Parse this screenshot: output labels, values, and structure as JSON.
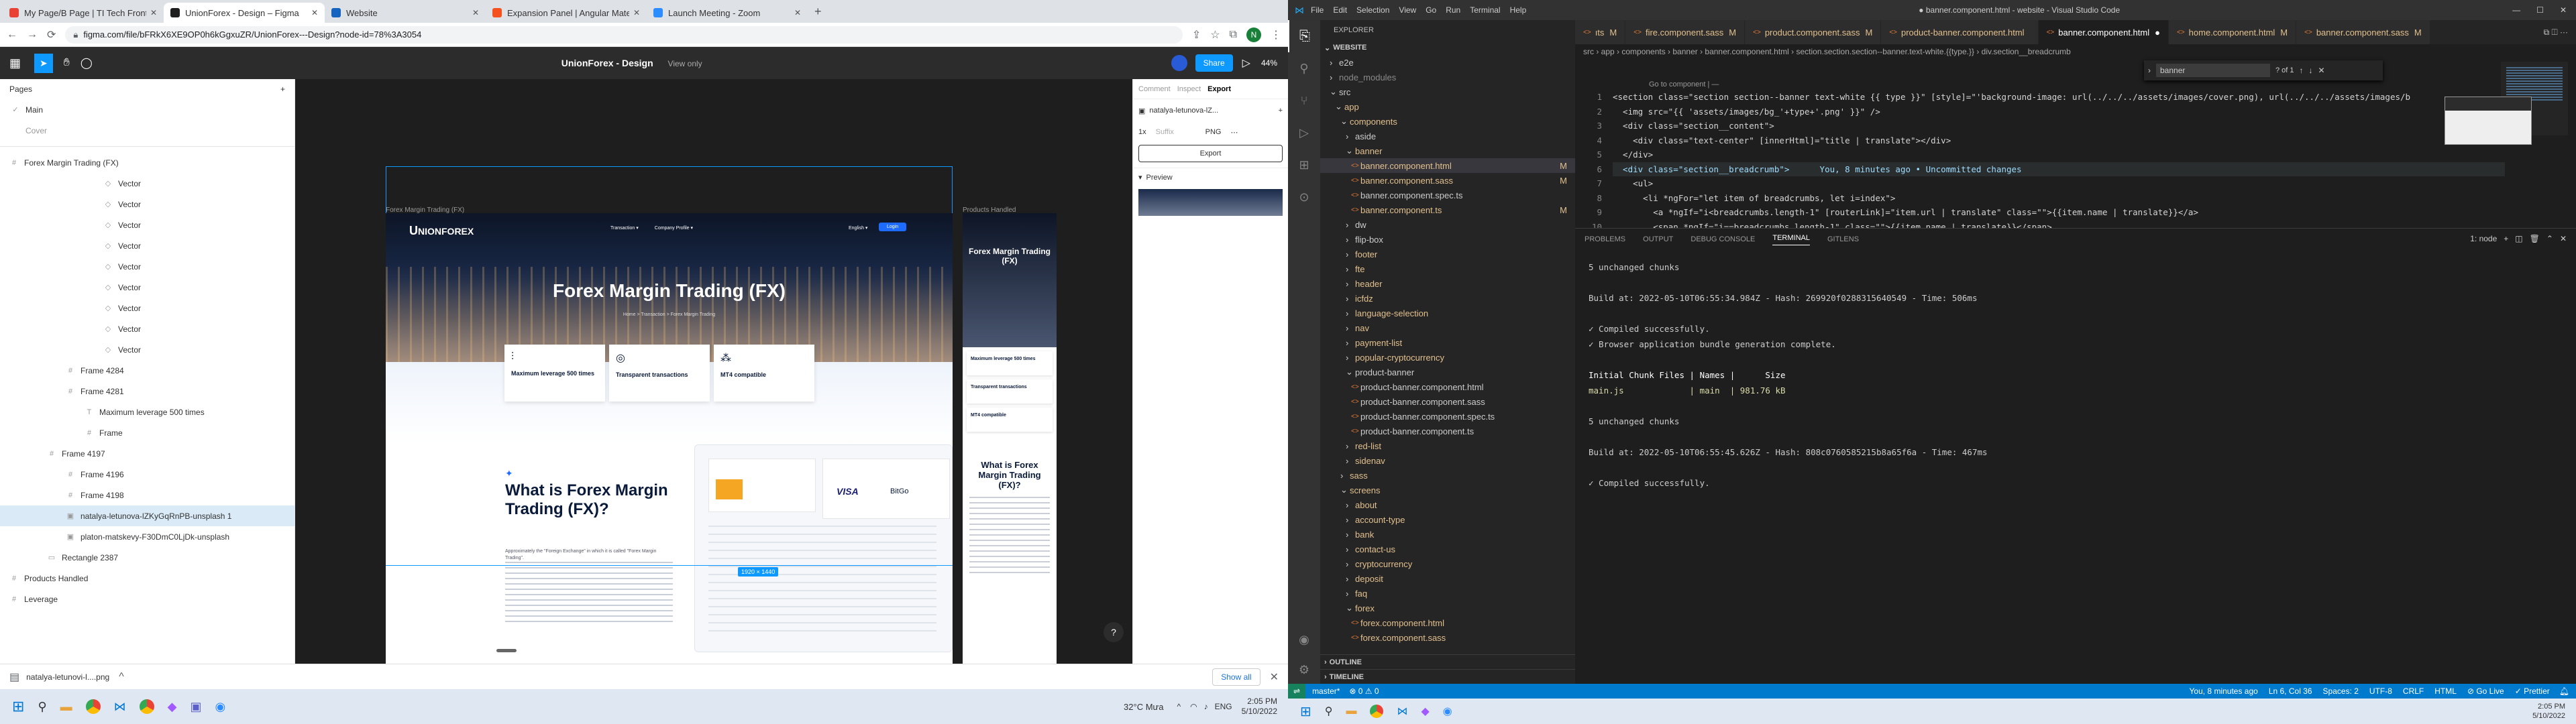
{
  "browser": {
    "tabs": [
      {
        "label": "My Page/B Page | TI Tech Front-...",
        "fav": "#e94235"
      },
      {
        "label": "UnionForex - Design – Figma",
        "fav": "#1e1e1e",
        "active": true
      },
      {
        "label": "Website",
        "fav": "#1565c0"
      },
      {
        "label": "Expansion Panel | Angular Mate...",
        "fav": "#f4511e"
      },
      {
        "label": "Launch Meeting - Zoom",
        "fav": "#2d8cff"
      }
    ],
    "url": "figma.com/file/bFRkX6XE9OP0h6kGgxuZR/UnionForex---Design?node-id=78%3A3054"
  },
  "figma": {
    "file_title": "UnionForex - Design",
    "view_mode": "View only",
    "share_label": "Share",
    "zoom": "44%",
    "pages_label": "Pages",
    "pages": [
      "Main",
      "Cover"
    ],
    "layers": [
      {
        "label": "Forex Margin Trading (FX)",
        "indent": 0,
        "icon": "#"
      },
      {
        "label": "Vector",
        "indent": 5,
        "icon": "◇"
      },
      {
        "label": "Vector",
        "indent": 5,
        "icon": "◇"
      },
      {
        "label": "Vector",
        "indent": 5,
        "icon": "◇"
      },
      {
        "label": "Vector",
        "indent": 5,
        "icon": "◇"
      },
      {
        "label": "Vector",
        "indent": 5,
        "icon": "◇"
      },
      {
        "label": "Vector",
        "indent": 5,
        "icon": "◇"
      },
      {
        "label": "Vector",
        "indent": 5,
        "icon": "◇"
      },
      {
        "label": "Vector",
        "indent": 5,
        "icon": "◇"
      },
      {
        "label": "Vector",
        "indent": 5,
        "icon": "◇"
      },
      {
        "label": "Frame 4284",
        "indent": 3,
        "icon": "#"
      },
      {
        "label": "Frame 4281",
        "indent": 3,
        "icon": "#"
      },
      {
        "label": "Maximum leverage 500 times",
        "indent": 4,
        "icon": "T"
      },
      {
        "label": "Frame",
        "indent": 4,
        "icon": "#"
      },
      {
        "label": "Frame 4197",
        "indent": 2,
        "icon": "#"
      },
      {
        "label": "Frame 4196",
        "indent": 3,
        "icon": "#"
      },
      {
        "label": "Frame 4198",
        "indent": 3,
        "icon": "#"
      },
      {
        "label": "natalya-letunova-lZKyGqRnPB-unsplash 1",
        "indent": 3,
        "icon": "▣",
        "selected": true
      },
      {
        "label": "platon-matskevy-F30DmC0LjDk-unsplash",
        "indent": 3,
        "icon": "▣"
      },
      {
        "label": "Rectangle 2387",
        "indent": 2,
        "icon": "▭"
      },
      {
        "label": "Products Handled",
        "indent": 0,
        "icon": "#"
      },
      {
        "label": "Leverage",
        "indent": 0,
        "icon": "#"
      }
    ],
    "right": {
      "tabs": [
        "Comment",
        "Inspect",
        "Export"
      ],
      "node_name": "natalya-letunova-lZ...",
      "scale": "1x",
      "suffix": "Suffix",
      "format": "PNG",
      "export_btn": "Export",
      "preview_label": "Preview"
    },
    "canvas": {
      "frame_label": "Forex Margin Trading (FX)",
      "frame2_label": "Products Handled",
      "hero_title": "Forex Margin Trading (FX)",
      "logo": "NIONFOREX",
      "logo_u": "U",
      "breadcrumb": "Home  >  Transaction  >  Forex Margin Trading",
      "nav": [
        "Transaction ▾",
        "Company Profile ▾"
      ],
      "lang": "English ▾",
      "login": "Login",
      "features": [
        "Maximum leverage 500 times",
        "Transparent transactions",
        "MT4 compatible"
      ],
      "what_title": "What is Forex Margin Trading (FX)?",
      "what_body": "Approximately the \"Foreign Exchange\" in which it is called \"Forex Margin Trading\".",
      "size_badge": "1920 × 1440",
      "visa": "VISA",
      "bitgo": "BitGo",
      "side_title": "Forex Margin Trading (FX)",
      "side_items": [
        "Maximum leverage 500 times",
        "Transparent transactions",
        "MT4 compatible"
      ],
      "side_what": "What is Forex Margin Trading (FX)?"
    },
    "download": {
      "file": "natalya-letunovi-l....png",
      "show_all": "Show all"
    }
  },
  "taskbar": {
    "weather": "32°C Mưa",
    "lang": "ENG",
    "time": "2:05 PM",
    "date": "5/10/2022"
  },
  "vscode": {
    "title": "● banner.component.html - website - Visual Studio Code",
    "menu": [
      "File",
      "Edit",
      "Selection",
      "View",
      "Go",
      "Run",
      "Terminal",
      "Help"
    ],
    "explorer_label": "EXPLORER",
    "workspace": "WEBSITE",
    "tree": [
      {
        "label": "e2e",
        "indent": 1,
        "type": "folder",
        "color": "#ccc"
      },
      {
        "label": "node_modules",
        "indent": 1,
        "type": "folder",
        "color": "#8a8a8a"
      },
      {
        "label": "src",
        "indent": 1,
        "type": "folder-open",
        "color": "#ccc"
      },
      {
        "label": "app",
        "indent": 2,
        "type": "folder-open",
        "color": "#e2c08d"
      },
      {
        "label": "components",
        "indent": 3,
        "type": "folder-open",
        "color": "#e2c08d"
      },
      {
        "label": "aside",
        "indent": 4,
        "type": "folder",
        "color": "#ccc"
      },
      {
        "label": "banner",
        "indent": 4,
        "type": "folder-open",
        "color": "#e2c08d"
      },
      {
        "label": "banner.component.html",
        "indent": 5,
        "type": "file",
        "color": "#e2c08d",
        "m": "M",
        "sel": true
      },
      {
        "label": "banner.component.sass",
        "indent": 5,
        "type": "file",
        "color": "#e2c08d",
        "m": "M"
      },
      {
        "label": "banner.component.spec.ts",
        "indent": 5,
        "type": "file",
        "color": "#ccc"
      },
      {
        "label": "banner.component.ts",
        "indent": 5,
        "type": "file",
        "color": "#e2c08d",
        "m": "M"
      },
      {
        "label": "dw",
        "indent": 4,
        "type": "folder",
        "color": "#ccc"
      },
      {
        "label": "flip-box",
        "indent": 4,
        "type": "folder",
        "color": "#ccc"
      },
      {
        "label": "footer",
        "indent": 4,
        "type": "folder",
        "color": "#e2c08d"
      },
      {
        "label": "fte",
        "indent": 4,
        "type": "folder",
        "color": "#e2c08d"
      },
      {
        "label": "header",
        "indent": 4,
        "type": "folder",
        "color": "#e2c08d"
      },
      {
        "label": "icfdz",
        "indent": 4,
        "type": "folder",
        "color": "#e2c08d"
      },
      {
        "label": "language-selection",
        "indent": 4,
        "type": "folder",
        "color": "#e2c08d"
      },
      {
        "label": "nav",
        "indent": 4,
        "type": "folder",
        "color": "#e2c08d"
      },
      {
        "label": "payment-list",
        "indent": 4,
        "type": "folder",
        "color": "#e2c08d"
      },
      {
        "label": "popular-cryptocurrency",
        "indent": 4,
        "type": "folder",
        "color": "#e2c08d"
      },
      {
        "label": "product-banner",
        "indent": 4,
        "type": "folder-open",
        "color": "#ccc"
      },
      {
        "label": "product-banner.component.html",
        "indent": 5,
        "type": "file",
        "color": "#ccc"
      },
      {
        "label": "product-banner.component.sass",
        "indent": 5,
        "type": "file",
        "color": "#ccc"
      },
      {
        "label": "product-banner.component.spec.ts",
        "indent": 5,
        "type": "file",
        "color": "#ccc"
      },
      {
        "label": "product-banner.component.ts",
        "indent": 5,
        "type": "file",
        "color": "#ccc"
      },
      {
        "label": "red-list",
        "indent": 4,
        "type": "folder",
        "color": "#e2c08d"
      },
      {
        "label": "sidenav",
        "indent": 4,
        "type": "folder",
        "color": "#e2c08d"
      },
      {
        "label": "sass",
        "indent": 3,
        "type": "folder",
        "color": "#e2c08d"
      },
      {
        "label": "screens",
        "indent": 3,
        "type": "folder-open",
        "color": "#e2c08d"
      },
      {
        "label": "about",
        "indent": 4,
        "type": "folder",
        "color": "#e2c08d"
      },
      {
        "label": "account-type",
        "indent": 4,
        "type": "folder",
        "color": "#e2c08d"
      },
      {
        "label": "bank",
        "indent": 4,
        "type": "folder",
        "color": "#e2c08d"
      },
      {
        "label": "contact-us",
        "indent": 4,
        "type": "folder",
        "color": "#e2c08d"
      },
      {
        "label": "cryptocurrency",
        "indent": 4,
        "type": "folder",
        "color": "#e2c08d"
      },
      {
        "label": "deposit",
        "indent": 4,
        "type": "folder",
        "color": "#e2c08d"
      },
      {
        "label": "faq",
        "indent": 4,
        "type": "folder",
        "color": "#e2c08d"
      },
      {
        "label": "forex",
        "indent": 4,
        "type": "folder-open",
        "color": "#e2c08d"
      },
      {
        "label": "forex.component.html",
        "indent": 5,
        "type": "file",
        "color": "#e2c08d"
      },
      {
        "label": "forex.component.sass",
        "indent": 5,
        "type": "file",
        "color": "#e2c08d"
      }
    ],
    "outline_label": "OUTLINE",
    "timeline_label": "TIMELINE",
    "tabs": [
      {
        "label": "ıts",
        "m": "M"
      },
      {
        "label": "fire.component.sass",
        "m": "M"
      },
      {
        "label": "product.component.sass",
        "m": "M"
      },
      {
        "label": "product-banner.component.html",
        "m": ""
      },
      {
        "label": "banner.component.html",
        "m": "●",
        "active": true
      },
      {
        "label": "home.component.html",
        "m": "M"
      },
      {
        "label": "banner.component.sass",
        "m": "M"
      }
    ],
    "breadcrumb": "src › app › components › banner › banner.component.html › section.section.section--banner.text-white.{{type.}} › div.section__breadcrumb",
    "goto": "Go to component | —",
    "find": {
      "value": "banner",
      "count": "? of 1"
    },
    "code": [
      "<section class=\"section section--banner text-white {{ type }}\" [style]=\"'background-image: url(../../../assets/images/cover.png), url(../../../assets/images/b",
      "  <img src=\"{{ 'assets/images/bg_'+type+'.png' }}\" />",
      "  <div class=\"section__content\">",
      "    <div class=\"text-center\" [innerHtml]=\"title | translate\"></div>",
      "  </div>",
      "  <div class=\"section__breadcrumb\">      You, 8 minutes ago • Uncommitted changes",
      "    <ul>",
      "      <li *ngFor=\"let item of breadcrumbs, let i=index\">",
      "        <a *ngIf=\"i<breadcrumbs.length-1\" [routerLink]=\"item.url | translate\" class=\"\">{{item.name | translate}}</a>",
      "        <span *ngIf=\"i==breadcrumbs.length-1\" class=\"\">{{item.name | translate}}</span>",
      "      </li>",
      "    </ul>",
      "  </div>",
      "</section>",
      ""
    ],
    "panel_tabs": [
      "PROBLEMS",
      "OUTPUT",
      "DEBUG CONSOLE",
      "TERMINAL",
      "GITLENS"
    ],
    "terminal_shell": "1: node",
    "terminal": [
      "5 unchanged chunks",
      "",
      "Build at: 2022-05-10T06:55:34.984Z - Hash: 269920f0288315640549 - Time: 506ms",
      "",
      "✓ Compiled successfully.",
      "✓ Browser application bundle generation complete.",
      "",
      "Initial Chunk Files | Names |      Size",
      "main.js             | main  | 981.76 kB",
      "",
      "5 unchanged chunks",
      "",
      "Build at: 2022-05-10T06:55:45.626Z - Hash: 808c0760585215b8a65f6a - Time: 467ms",
      "",
      "✓ Compiled successfully."
    ],
    "status_left": [
      "master*",
      "⊗ 0  ⚠ 0"
    ],
    "status_right": [
      "You, 8 minutes ago",
      "Ln 6, Col 36",
      "Spaces: 2",
      "UTF-8",
      "CRLF",
      "HTML",
      "⊘ Go Live",
      "✓ Prettier"
    ]
  }
}
